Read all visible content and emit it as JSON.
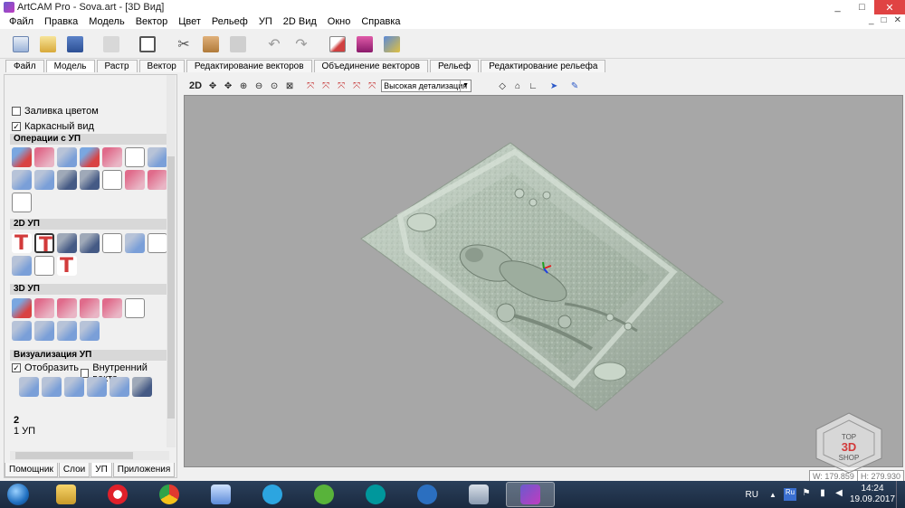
{
  "window": {
    "title": "ArtCAM Pro - Sova.art - [3D Вид]",
    "controls": [
      "_",
      "□",
      "✕"
    ],
    "mdi_controls": [
      "_",
      "□",
      "✕"
    ]
  },
  "menu": [
    "Файл",
    "Правка",
    "Модель",
    "Вектор",
    "Цвет",
    "Рельеф",
    "УП",
    "2D Вид",
    "Окно",
    "Справка"
  ],
  "toolbar_icons": [
    "new-file-icon",
    "open-folder-icon",
    "save-icon",
    "print-icon",
    "display-icon",
    "cut-icon",
    "copy-icon",
    "paste-icon",
    "undo-icon",
    "redo-icon",
    "edit-icon",
    "book-icon",
    "tools-icon"
  ],
  "tabs": [
    {
      "label": "Файл",
      "active": false
    },
    {
      "label": "Модель",
      "active": true
    },
    {
      "label": "Растр",
      "active": false
    },
    {
      "label": "Вектор",
      "active": false
    },
    {
      "label": "Редактирование векторов",
      "active": false
    },
    {
      "label": "Объединение векторов",
      "active": false
    },
    {
      "label": "Рельеф",
      "active": false
    },
    {
      "label": "Редактирование рельефа",
      "active": false
    }
  ],
  "left_panel": {
    "fill_color_label": "Заливка цветом",
    "fill_color_checked": false,
    "wireframe_label": "Каркасный вид",
    "wireframe_checked": true,
    "sections": {
      "toolpath_ops": "Операции с УП",
      "toolpath_2d": "2D УП",
      "toolpath_3d": "3D УП",
      "toolpath_vis": "Визуализация УП"
    },
    "show_label": "Отобразить",
    "show_checked": true,
    "inner_vector_label": "Внутренний векто",
    "inner_vector_checked": false,
    "count": "2",
    "toolpath_item": "1 УП",
    "bottom_tabs": [
      {
        "label": "Помощник",
        "active": false
      },
      {
        "label": "Слои",
        "active": false
      },
      {
        "label": "УП",
        "active": true
      },
      {
        "label": "Приложения",
        "active": false
      }
    ]
  },
  "view_toolbar": {
    "mode_2d": "2D",
    "detail_level": "Высокая детализация"
  },
  "status": {
    "width": "W: 179.859",
    "height": "H: 279.930"
  },
  "watermark": {
    "line1": "TOP",
    "line2": "3D",
    "line3": "SHOP"
  },
  "taskbar": {
    "lang": "RU",
    "tray_lang": "Ru",
    "time": "14:24",
    "date": "19.09.2017"
  },
  "colors": {
    "view_bg": "#a7a7a7",
    "close_button": "#e04343",
    "taskbar": "#1f3049"
  }
}
